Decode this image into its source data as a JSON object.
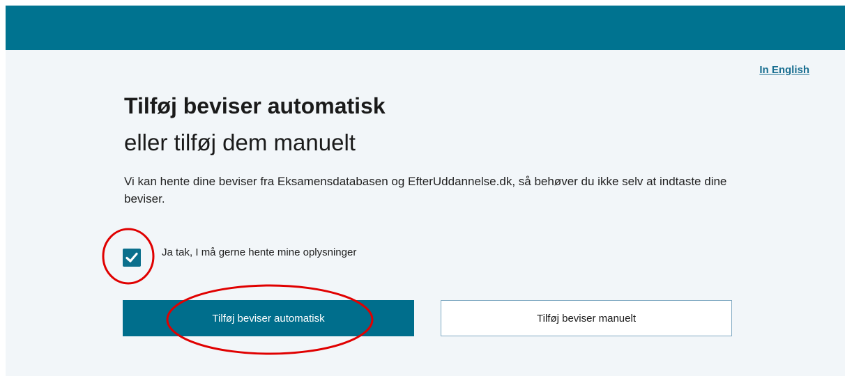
{
  "header": {
    "bar_color": "#007390",
    "language_link": "In English"
  },
  "main": {
    "title": "Tilføj beviser automatisk",
    "subtitle": "eller tilføj dem manuelt",
    "intro": "Vi kan hente dine beviser fra Eksamensdatabasen og EfterUddannelse.dk, så behøver du ikke selv at indtaste dine beviser.",
    "consent": {
      "checked": true,
      "label": "Ja tak, I må gerne hente mine oplysninger"
    },
    "buttons": {
      "automatic_label": "Tilføj beviser automatisk",
      "manual_label": "Tilføj beviser manuelt"
    }
  },
  "annotations": {
    "color": "#e00000",
    "highlights": [
      "checkbox",
      "automatic-button"
    ]
  },
  "icons": {
    "checkbox": "checkmark-icon"
  }
}
